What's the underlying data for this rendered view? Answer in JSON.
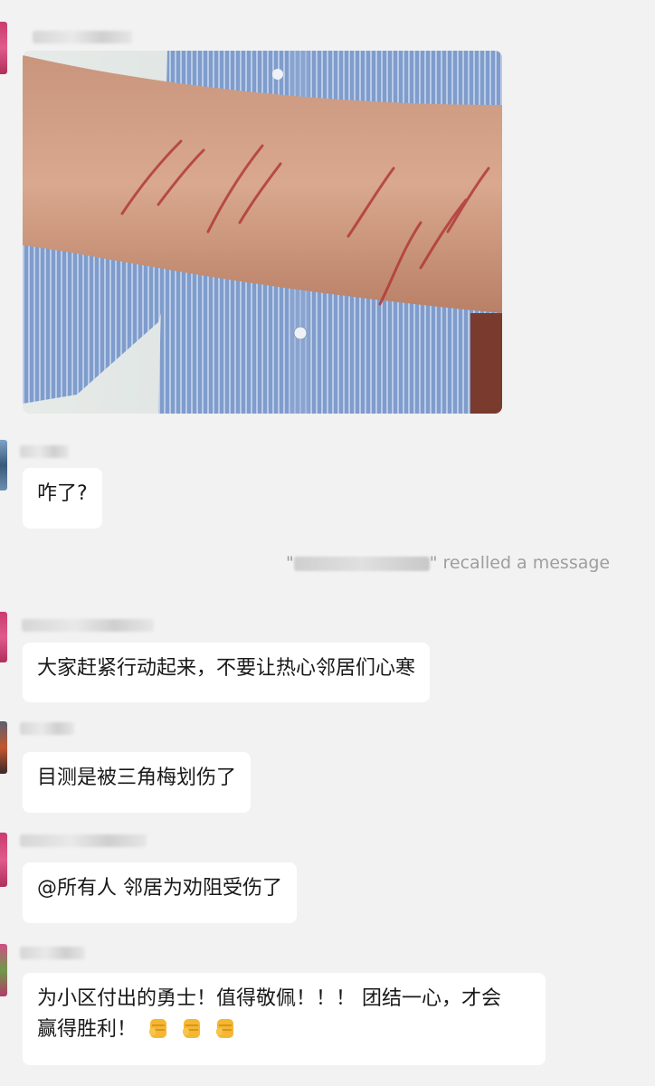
{
  "messages": [
    {
      "type": "image",
      "alt_icon": "arm-scratches-photo"
    },
    {
      "type": "text",
      "text": "咋了?"
    },
    {
      "type": "system",
      "prefix": "\"",
      "suffix": "\" recalled a message"
    },
    {
      "type": "text",
      "text": "大家赶紧行动起来，不要让热心邻居们心寒"
    },
    {
      "type": "text",
      "text": "目测是被三角梅划伤了"
    },
    {
      "type": "text",
      "text": "@所有人  邻居为劝阻受伤了"
    },
    {
      "type": "text",
      "text_line1": "为小区付出的勇士！值得敬佩！！！ 团结一心，才会",
      "text_line2": "赢得胜利！",
      "emoji_icon": "raised-fist-emoji",
      "emoji_count": 3
    }
  ],
  "colors": {
    "background": "#f2f2f2",
    "bubble": "#ffffff",
    "system_text": "#9e9e9e",
    "fist": "#f5b731"
  }
}
